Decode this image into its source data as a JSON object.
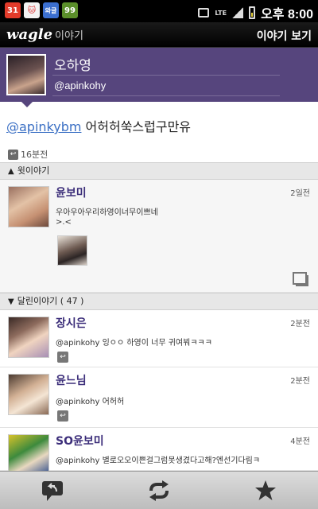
{
  "status_bar": {
    "icons": [
      "calendar-icon",
      "cat-icon",
      "wagle-icon",
      "tag-icon"
    ],
    "calendar_date": "31",
    "wagle_label": "와글",
    "tag_label": "99",
    "network": "LTE",
    "time": "오후 8:00"
  },
  "app_header": {
    "logo": "wagle",
    "logo_suffix": "이야기",
    "title": "이야기 보기"
  },
  "profile": {
    "name": "오하영",
    "handle": "@apinkohy"
  },
  "post": {
    "mention": "@apinkybm",
    "text": " 어허허쑥스럽구만유",
    "time": "16분전"
  },
  "sections": {
    "parent_label": "윗이야기",
    "replies_label": "달린이야기 ( 47 )"
  },
  "parent_story": {
    "name": "윤보미",
    "time": "2일전",
    "line1": "우아우아우리하영이너무이쁘네",
    "line2": ">.<"
  },
  "replies": [
    {
      "name": "장시은",
      "time": "2분전",
      "text": "@apinkohy 잉ㅇㅇ 하영이 너무 귀여붜ㅋㅋㅋ"
    },
    {
      "name": "윤느님",
      "time": "2분전",
      "text": "@apinkohy 어허허"
    },
    {
      "name": "SO윤보미",
      "time": "4분전",
      "text": "@apinkohy 별로오오이쁜걸그럼못생겼다고해?엔선기다림ㅋ"
    }
  ],
  "bottom_bar": {
    "buttons": [
      "reply-icon",
      "retweet-icon",
      "favorite-star-icon"
    ]
  },
  "colors": {
    "profile_bg": "#56457d",
    "name_color": "#3c2e7a",
    "mention_color": "#3a6fc4"
  }
}
